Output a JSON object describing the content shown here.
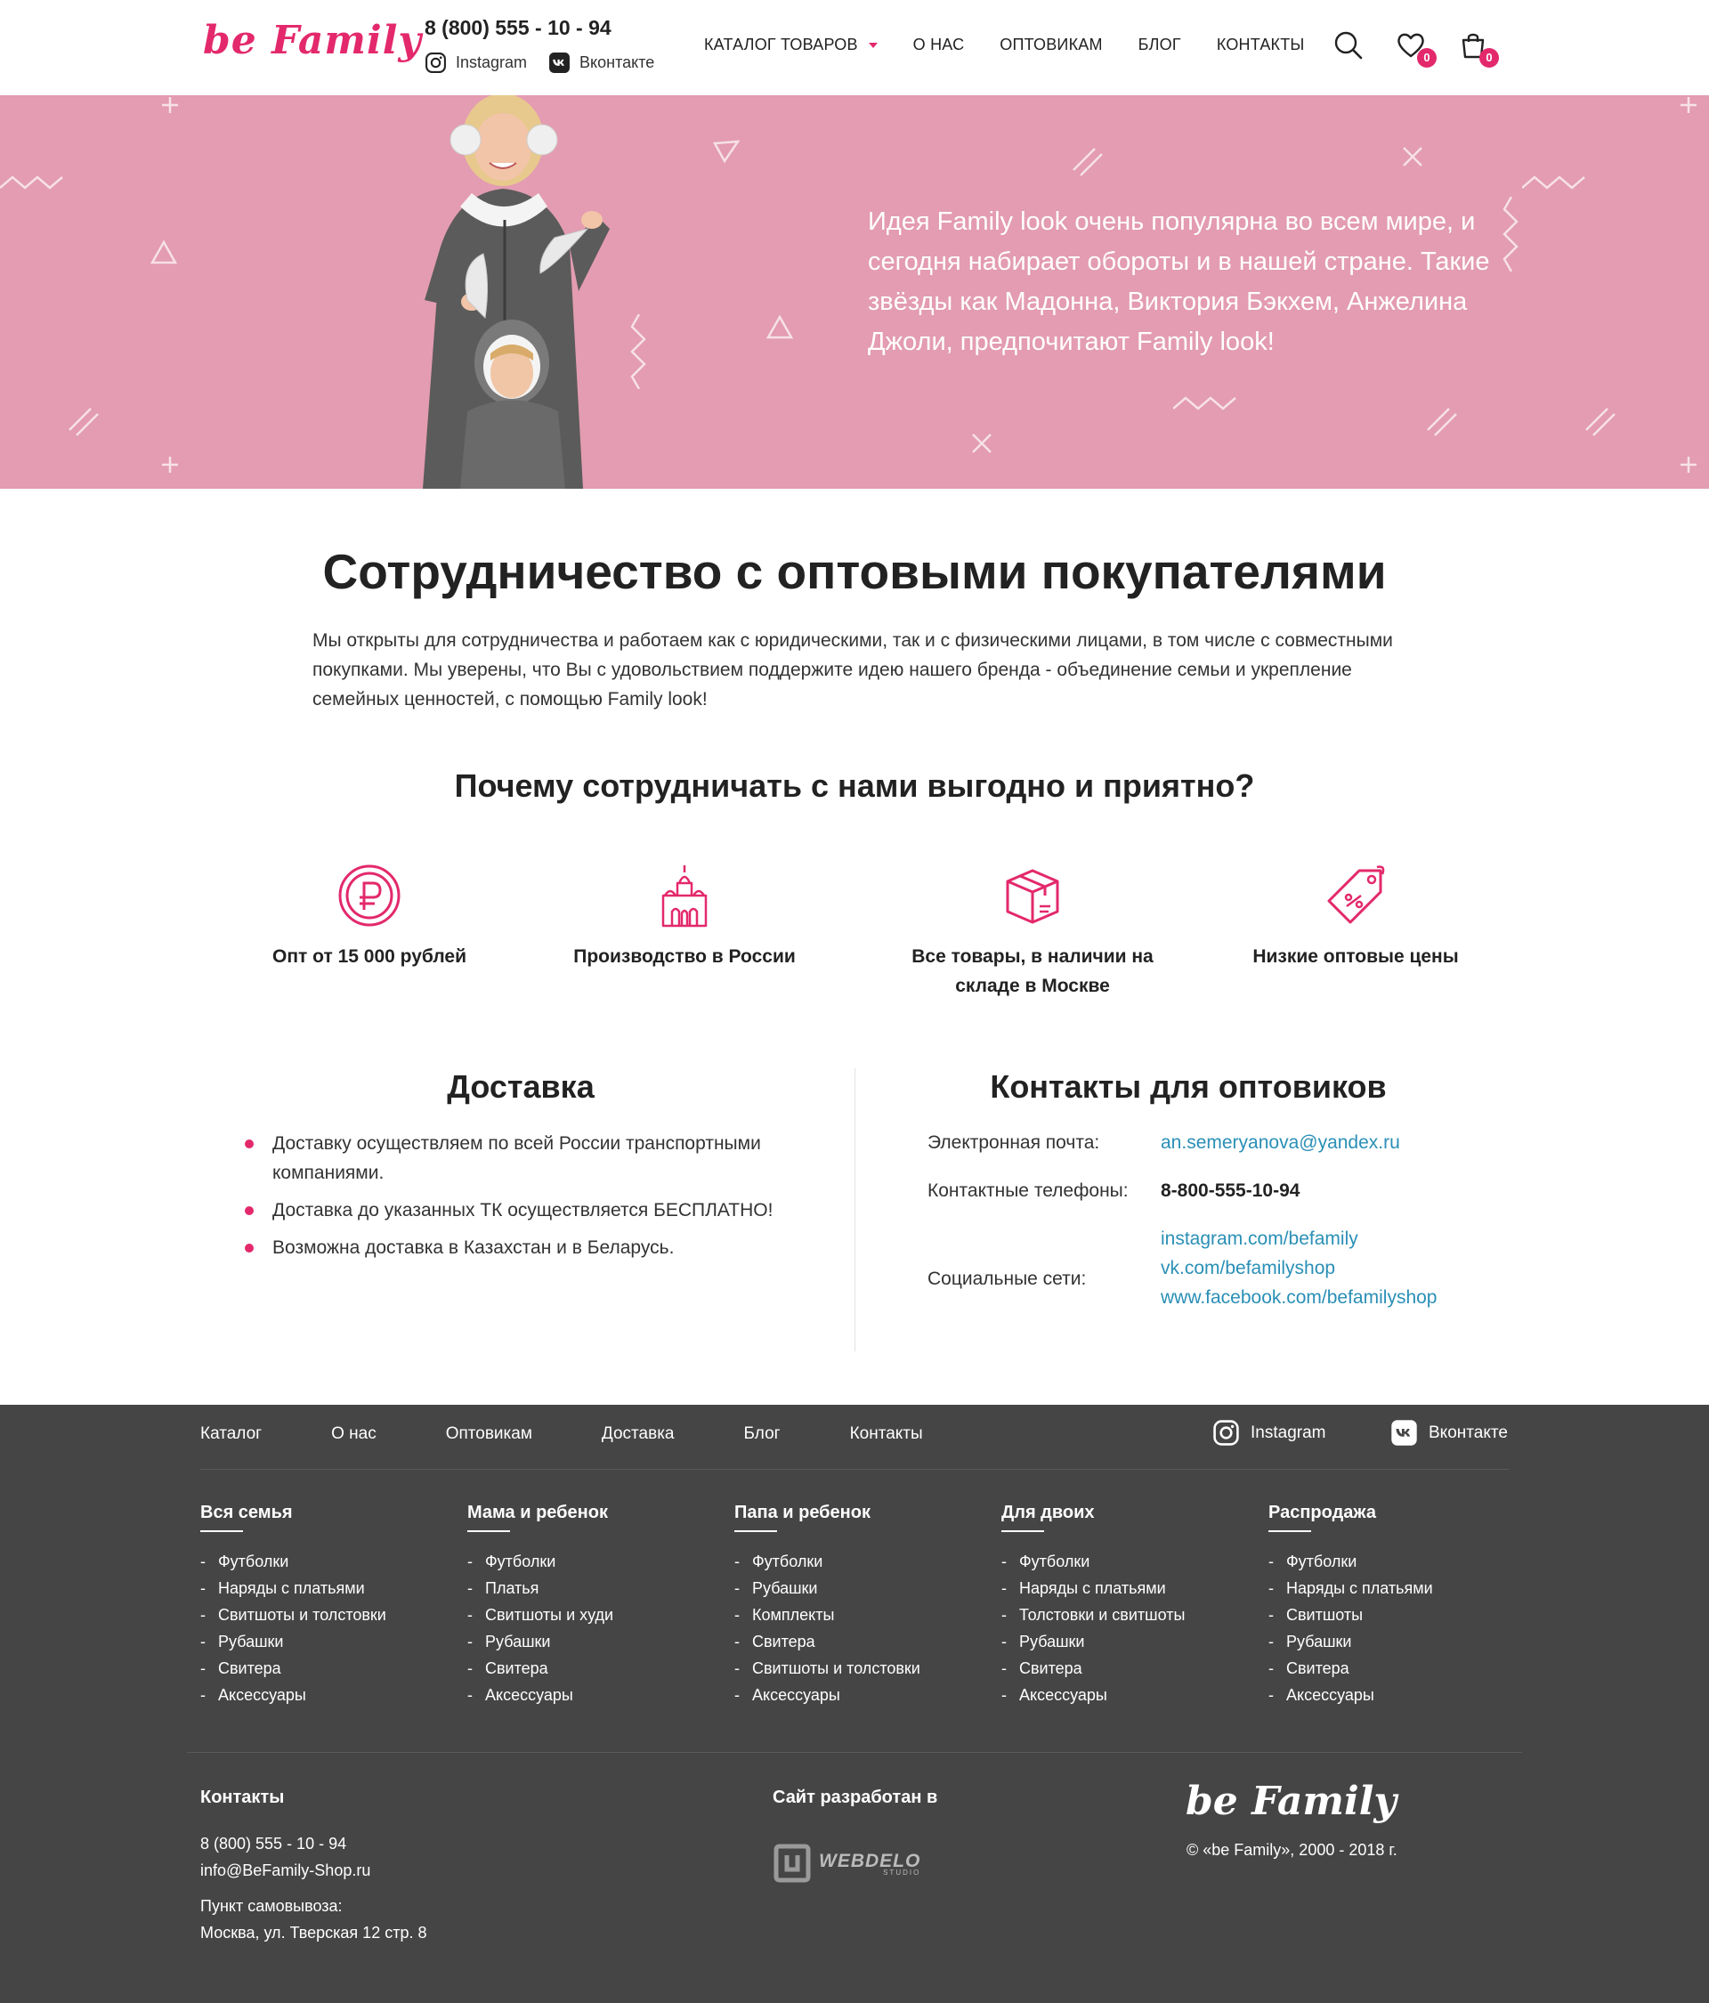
{
  "brand": {
    "name": "be Family",
    "accent": "#e3296b",
    "hero_bg": "#e39cb1",
    "footer_bg": "#454545",
    "link": "#2a8fb6"
  },
  "header": {
    "phone": "8 (800) 555 - 10 - 94",
    "instagram": "Instagram",
    "vk": "Вконтакте",
    "nav": [
      "КАТАЛОГ ТОВАРОВ",
      "О НАС",
      "ОПТОВИКАМ",
      "БЛОГ",
      "КОНТАКТЫ"
    ],
    "wishlist_count": "0",
    "cart_count": "0",
    "icons": [
      "search-icon",
      "heart-icon",
      "cart-icon"
    ]
  },
  "hero": {
    "text": "Идея Family look очень популярна во всем мире, и сегодня набирает обороты и в нашей стране. Такие звёзды как Мадонна, Виктория Бэкхем, Анжелина Джоли, предпочитают Family look!"
  },
  "main": {
    "title": "Сотрудничество с оптовыми покупателями",
    "intro": "Мы открыты для сотрудничества и работаем как с юридическими, так и с физическими лицами, в том числе с совместными покупками. Мы уверены, что Вы с удовольствием поддержите идею нашего бренда - объединение семьи и укрепление семейных ценностей, с помощью Family look!",
    "why_title": "Почему сотрудничать с нами выгодно и приятно?",
    "features": [
      {
        "label": "Опт от 15 000 рублей",
        "icon": "ruble-coin-icon"
      },
      {
        "label": "Производство в России",
        "icon": "kremlin-icon"
      },
      {
        "label": "Все товары, в наличии на складе в Москве",
        "icon": "box-icon"
      },
      {
        "label": "Низкие оптовые цены",
        "icon": "price-tag-icon"
      }
    ]
  },
  "delivery": {
    "title": "Доставка",
    "items": [
      "Доставку осуществляем по всей России транспортными компаниями.",
      "Доставка до указанных ТК осуществляется БЕСПЛАТНО!",
      "Возможна доставка в Казахстан и в Беларусь."
    ]
  },
  "contacts": {
    "title": "Контакты для оптовиков",
    "email_label": "Электронная почта:",
    "email": "an.semeryanova@yandex.ru",
    "phone_label": "Контактные телефоны:",
    "phone": "8-800-555-10-94",
    "social_label": "Социальные сети:",
    "social": [
      "instagram.com/befamily",
      "vk.com/befamilyshop",
      "www.facebook.com/befamilyshop"
    ]
  },
  "footer": {
    "nav": [
      "Каталог",
      "О нас",
      "Оптовикам",
      "Доставка",
      "Блог",
      "Контакты"
    ],
    "instagram": "Instagram",
    "vk": "Вконтакте",
    "columns": [
      {
        "title": "Вся семья",
        "items": [
          "Футболки",
          "Наряды с платьями",
          "Свитшоты и толстовки",
          "Рубашки",
          "Свитера",
          "Аксессуары"
        ]
      },
      {
        "title": "Мама и ребенок",
        "items": [
          "Футболки",
          "Платья",
          "Свитшоты и худи",
          "Рубашки",
          "Свитера",
          "Аксессуары"
        ]
      },
      {
        "title": "Папа и ребенок",
        "items": [
          "Футболки",
          "Рубашки",
          "Комплекты",
          "Свитера",
          "Свитшоты и толстовки",
          "Аксессуары"
        ]
      },
      {
        "title": "Для двоих",
        "items": [
          "Футболки",
          "Наряды с платьями",
          "Толстовки и свитшоты",
          "Рубашки",
          "Свитера",
          "Аксессуары"
        ]
      },
      {
        "title": "Распродажа",
        "items": [
          "Футболки",
          "Наряды с платьями",
          "Свитшоты",
          "Рубашки",
          "Свитера",
          "Аксессуары"
        ]
      }
    ],
    "contacts_title": "Контакты",
    "phone": "8 (800) 555 - 10 - 94",
    "email": "info@BeFamily-Shop.ru",
    "pickup_label": "Пункт самовывоза:",
    "pickup_address": "Москва, ул. Тверская 12 стр. 8",
    "dev_title": "Сайт разработан в",
    "dev_name": "WEBDELO",
    "dev_sub": "STUDIO",
    "copyright": "© «be Family», 2000 - 2018 г."
  }
}
